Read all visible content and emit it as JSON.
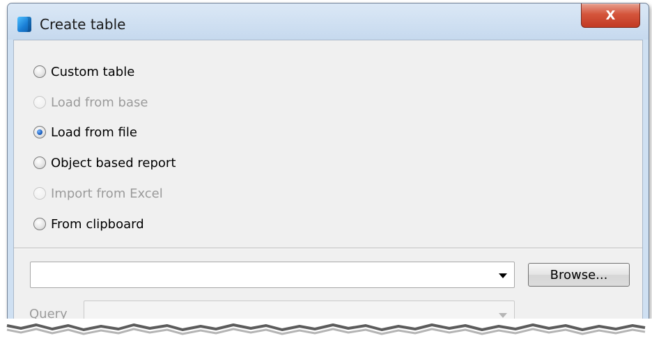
{
  "window": {
    "title": "Create table",
    "close_label": "X"
  },
  "options": [
    {
      "label": "Custom table",
      "checked": false,
      "disabled": false
    },
    {
      "label": "Load from base",
      "checked": false,
      "disabled": true
    },
    {
      "label": "Load from file",
      "checked": true,
      "disabled": false
    },
    {
      "label": "Object based report",
      "checked": false,
      "disabled": false
    },
    {
      "label": "Import from Excel",
      "checked": false,
      "disabled": true
    },
    {
      "label": "From clipboard",
      "checked": false,
      "disabled": false
    }
  ],
  "file_combo": {
    "value": ""
  },
  "browse": {
    "label": "Browse..."
  },
  "query": {
    "label": "Query",
    "value": ""
  },
  "icons": {
    "app": "app-icon",
    "close": "close-icon",
    "dropdown": "chevron-down-icon"
  },
  "colors": {
    "titlebar": "#c6d9ee",
    "close_button": "#c9432b",
    "client_bg": "#f0f0f0",
    "disabled_text": "#9a9a9a"
  }
}
